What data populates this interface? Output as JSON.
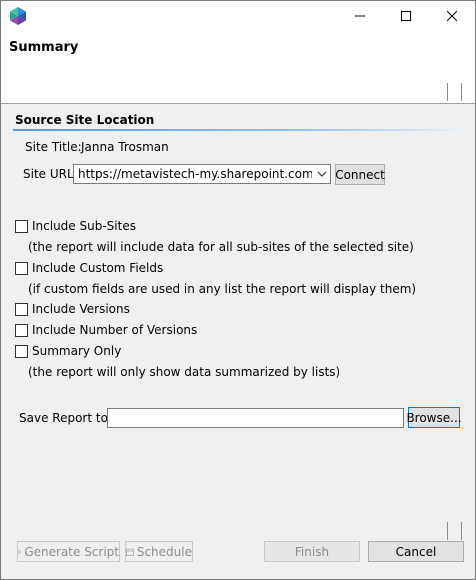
{
  "window": {
    "controls": {
      "minimize": "minimize-icon",
      "maximize": "maximize-icon",
      "close": "close-icon"
    }
  },
  "header": {
    "title": "Summary"
  },
  "source": {
    "section_title": "Source Site Location",
    "site_title_label": "Site Title:",
    "site_title_value": "Janna Trosman",
    "site_url_label": "Site URL:",
    "site_url_value": "https://metavistech-my.sharepoint.com/personal/janna_trosman",
    "connect_label": "Connect"
  },
  "options": {
    "include_subsites": {
      "label": "Include Sub-Sites",
      "checked": false,
      "note": "(the report will include data for all sub-sites of the selected site)"
    },
    "include_custom_fields": {
      "label": "Include Custom Fields",
      "checked": false,
      "note": "(if custom fields are used in any list the report will display them)"
    },
    "include_versions": {
      "label": "Include Versions",
      "checked": false
    },
    "include_number_of_versions": {
      "label": "Include Number of Versions",
      "checked": false
    },
    "summary_only": {
      "label": "Summary Only",
      "checked": false,
      "note": "(the report will only show data summarized by lists)"
    }
  },
  "save": {
    "label": "Save Report to:",
    "value": "",
    "browse_label": "Browse..."
  },
  "footer": {
    "generate_script_label": "Generate Script",
    "schedule_label": "Schedule",
    "finish_label": "Finish",
    "cancel_label": "Cancel"
  },
  "colors": {
    "accent_line": "#5b9bd5",
    "window_bg": "#f0f0f0",
    "disabled_text": "#8d8d8d"
  }
}
